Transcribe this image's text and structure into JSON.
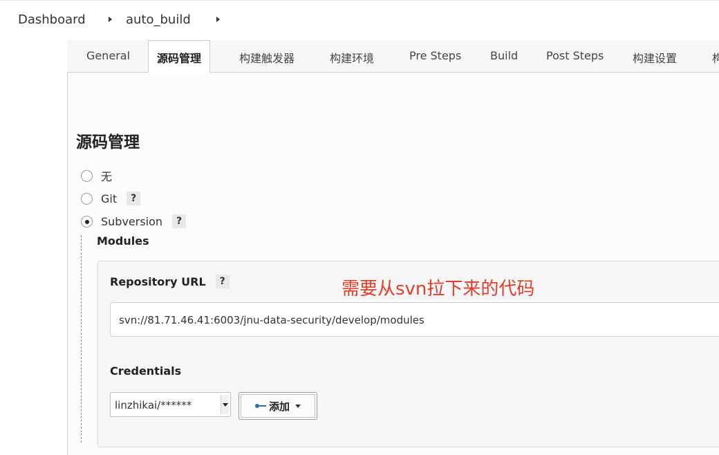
{
  "breadcrumb": {
    "items": [
      {
        "label": "Dashboard"
      },
      {
        "label": "auto_build"
      }
    ]
  },
  "tabs": [
    {
      "label": "General",
      "active": false
    },
    {
      "label": "源码管理",
      "active": true
    },
    {
      "label": "构建触发器",
      "active": false
    },
    {
      "label": "构建环境",
      "active": false
    },
    {
      "label": "Pre Steps",
      "active": false
    },
    {
      "label": "Build",
      "active": false
    },
    {
      "label": "Post Steps",
      "active": false
    },
    {
      "label": "构建设置",
      "active": false
    },
    {
      "label": "构",
      "active": false
    }
  ],
  "section": {
    "title": "源码管理"
  },
  "scm_options": [
    {
      "label": "无",
      "selected": false,
      "help": ""
    },
    {
      "label": "Git",
      "selected": false,
      "help": "?"
    },
    {
      "label": "Subversion",
      "selected": true,
      "help": "?"
    }
  ],
  "modules": {
    "label": "Modules",
    "repository_url": {
      "label": "Repository URL",
      "help": "?",
      "value": "svn://81.71.46.41:6003/jnu-data-security/develop/modules"
    },
    "annotation": "需要从svn拉下来的代码",
    "credentials": {
      "label": "Credentials",
      "selected": "linzhikai/******",
      "add_label": "添加"
    }
  },
  "colors": {
    "annotation": "#e53c2a",
    "key_icon": "#2b6fb0"
  },
  "icons": {
    "breadcrumb_separator": "chevron-right-icon",
    "key": "key-icon",
    "dropdown": "caret-down-icon"
  }
}
